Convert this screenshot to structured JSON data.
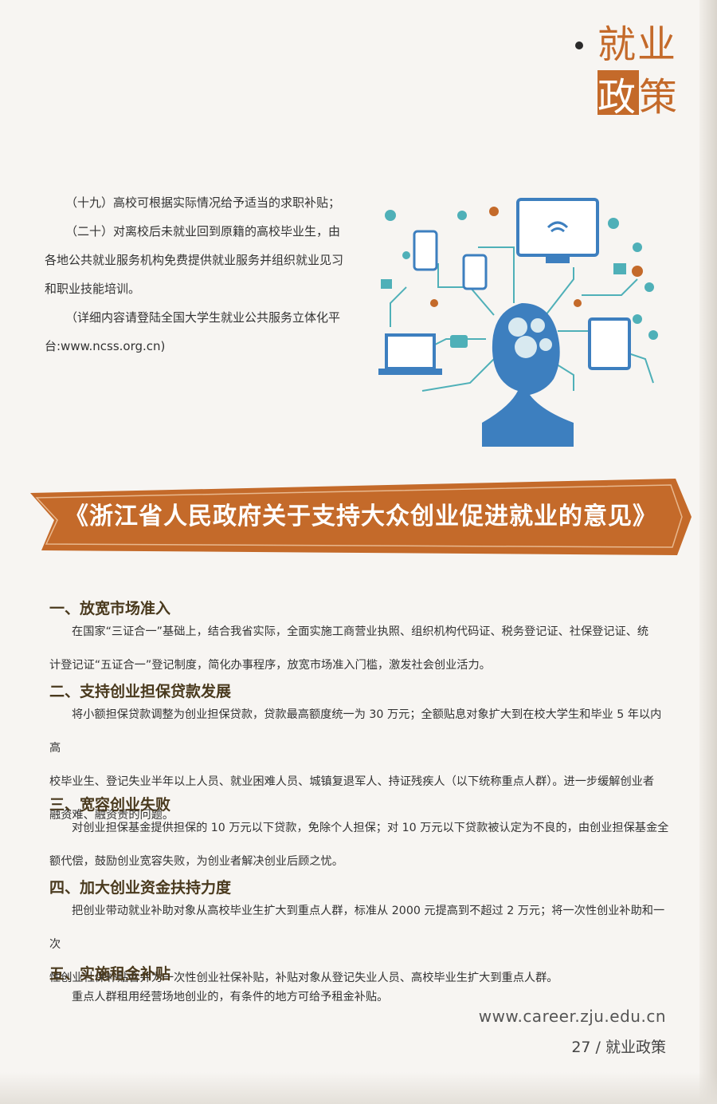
{
  "header": {
    "tag_line1": "就业",
    "tag_line2a": "政",
    "tag_line2b": "策",
    "accent": "#c46a2a"
  },
  "top_text": {
    "p1": "（十九）高校可根据实际情况给予适当的求职补贴；",
    "p2a": "（二十）对离校后未就业回到原籍的高校毕业生，由",
    "p2b": "各地公共就业服务机构免费提供就业服务并组织就业见习",
    "p2c": "和职业技能培训。",
    "p3a": "（详细内容请登陆全国大学生就业公共服务立体化平",
    "p3b": "台:www.ncss.org.cn)"
  },
  "banner": {
    "title": "《浙江省人民政府关于支持大众创业促进就业的意见》",
    "color": "#c46a2a"
  },
  "sections": [
    {
      "heading": "一、放宽市场准入",
      "lines": [
        "在国家“三证合一”基础上，结合我省实际，全面实施工商营业执照、组织机构代码证、税务登记证、社保登记证、统",
        "计登记证“五证合一”登记制度，简化办事程序，放宽市场准入门槛，激发社会创业活力。"
      ]
    },
    {
      "heading": "二、支持创业担保贷款发展",
      "lines": [
        "将小额担保贷款调整为创业担保贷款，贷款最高额度统一为 30 万元；全额贴息对象扩大到在校大学生和毕业 5 年以内高",
        "校毕业生、登记失业半年以上人员、就业困难人员、城镇复退军人、持证残疾人（以下统称重点人群）。进一步缓解创业者",
        "融资难、融资贵的问题。"
      ]
    },
    {
      "heading": "三、宽容创业失败",
      "lines": [
        "对创业担保基金提供担保的 10 万元以下贷款，免除个人担保；对 10 万元以下贷款被认定为不良的，由创业担保基金全",
        "额代偿，鼓励创业宽容失败，为创业者解决创业后顾之忧。"
      ]
    },
    {
      "heading": "四、加大创业资金扶持力度",
      "lines": [
        "把创业带动就业补助对象从高校毕业生扩大到重点人群，标准从 2000 元提高到不超过 2 万元；将一次性创业补助和一次",
        "性创业社保补贴合并为一次性创业社保补贴，补贴对象从登记失业人员、高校毕业生扩大到重点人群。"
      ]
    },
    {
      "heading": "五、实施租金补贴",
      "lines": [
        "重点人群租用经营场地创业的，有条件的地方可给予租金补贴。"
      ]
    }
  ],
  "footer": {
    "url": "www.career.zju.edu.cn",
    "page": "27 / 就业政策"
  }
}
